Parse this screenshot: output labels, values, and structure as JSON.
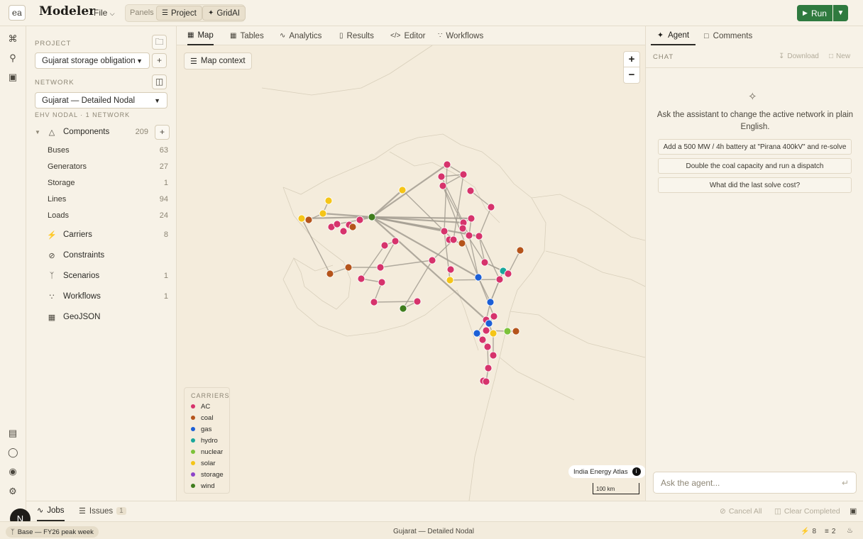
{
  "topbar": {
    "logo_text": "ea",
    "app_title": "Modeler",
    "file_menu": "File",
    "panels_label": "Panels",
    "panel_buttons": [
      "Project",
      "GridAI"
    ],
    "run_label": "Run"
  },
  "left": {
    "project_label": "PROJECT",
    "project_value": "Gujarat storage obligation",
    "network_label": "NETWORK",
    "network_value": "Gujarat — Detailed Nodal",
    "network_meta": "EHV NODAL · 1 NETWORK",
    "components_label": "Components",
    "components_count": "209",
    "component_items": [
      {
        "label": "Buses",
        "count": "63"
      },
      {
        "label": "Generators",
        "count": "27"
      },
      {
        "label": "Storage",
        "count": "1"
      },
      {
        "label": "Lines",
        "count": "94"
      },
      {
        "label": "Loads",
        "count": "24"
      }
    ],
    "sections": [
      {
        "label": "Carriers",
        "count": "8"
      },
      {
        "label": "Constraints",
        "count": ""
      },
      {
        "label": "Scenarios",
        "count": "1"
      },
      {
        "label": "Workflows",
        "count": "1"
      },
      {
        "label": "GeoJSON",
        "count": ""
      }
    ]
  },
  "center": {
    "tabs": [
      "Map",
      "Tables",
      "Analytics",
      "Results",
      "Editor",
      "Workflows"
    ],
    "map_context": "Map context",
    "zoom_in": "+",
    "zoom_out": "−",
    "attribution": "India Energy Atlas",
    "scale": "100 km"
  },
  "legend": {
    "title": "CARRIERS",
    "items": [
      {
        "label": "AC",
        "color": "#d6336c"
      },
      {
        "label": "coal",
        "color": "#b5541b"
      },
      {
        "label": "gas",
        "color": "#1c5fd6"
      },
      {
        "label": "hydro",
        "color": "#1aa79b"
      },
      {
        "label": "nuclear",
        "color": "#7cc23a"
      },
      {
        "label": "solar",
        "color": "#f5c518"
      },
      {
        "label": "storage",
        "color": "#8e44c9"
      },
      {
        "label": "wind",
        "color": "#3f7d1d"
      }
    ]
  },
  "right": {
    "tabs": [
      "Agent",
      "Comments"
    ],
    "chat_label": "CHAT",
    "download_label": "Download",
    "new_label": "New",
    "prompt_text": "Ask the assistant to change the active network in plain English.",
    "suggestions": [
      "Add a 500 MW / 4h battery at \"Pirana 400kV\" and re-solve",
      "Double the coal capacity and run a dispatch",
      "What did the last solve cost?"
    ],
    "input_placeholder": "Ask the agent..."
  },
  "bottom": {
    "jobs_label": "Jobs",
    "issues_label": "Issues",
    "issues_count": "1",
    "cancel_all": "Cancel All",
    "clear_completed": "Clear Completed"
  },
  "status": {
    "branch": "Base — FY26 peak week",
    "network": "Gujarat — Detailed Nodal",
    "count_a": "8",
    "count_b": "2"
  },
  "user_initial": "N",
  "accent_color": "#2f7a3f"
}
